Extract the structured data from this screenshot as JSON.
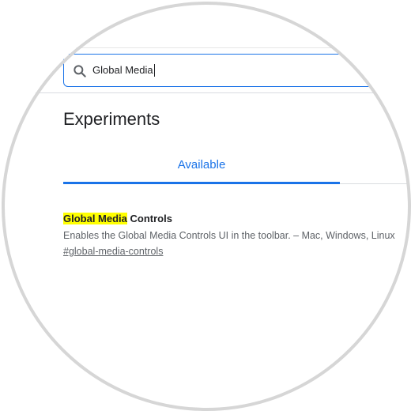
{
  "search": {
    "value": "Global Media"
  },
  "page": {
    "title": "Experiments"
  },
  "tabs": [
    {
      "label": "Available",
      "active": true
    }
  ],
  "experiment": {
    "title_highlight": "Global Media",
    "title_rest": " Controls",
    "description": "Enables the Global Media Controls UI in the toolbar. – Mac, Windows, Linux",
    "link": "#global-media-controls"
  },
  "colors": {
    "accent": "#1a73e8",
    "highlight": "#ffff00",
    "text": "#202124",
    "muted": "#5f6368",
    "ring": "#d6d6d6"
  },
  "icons": {
    "search": "search-icon"
  }
}
